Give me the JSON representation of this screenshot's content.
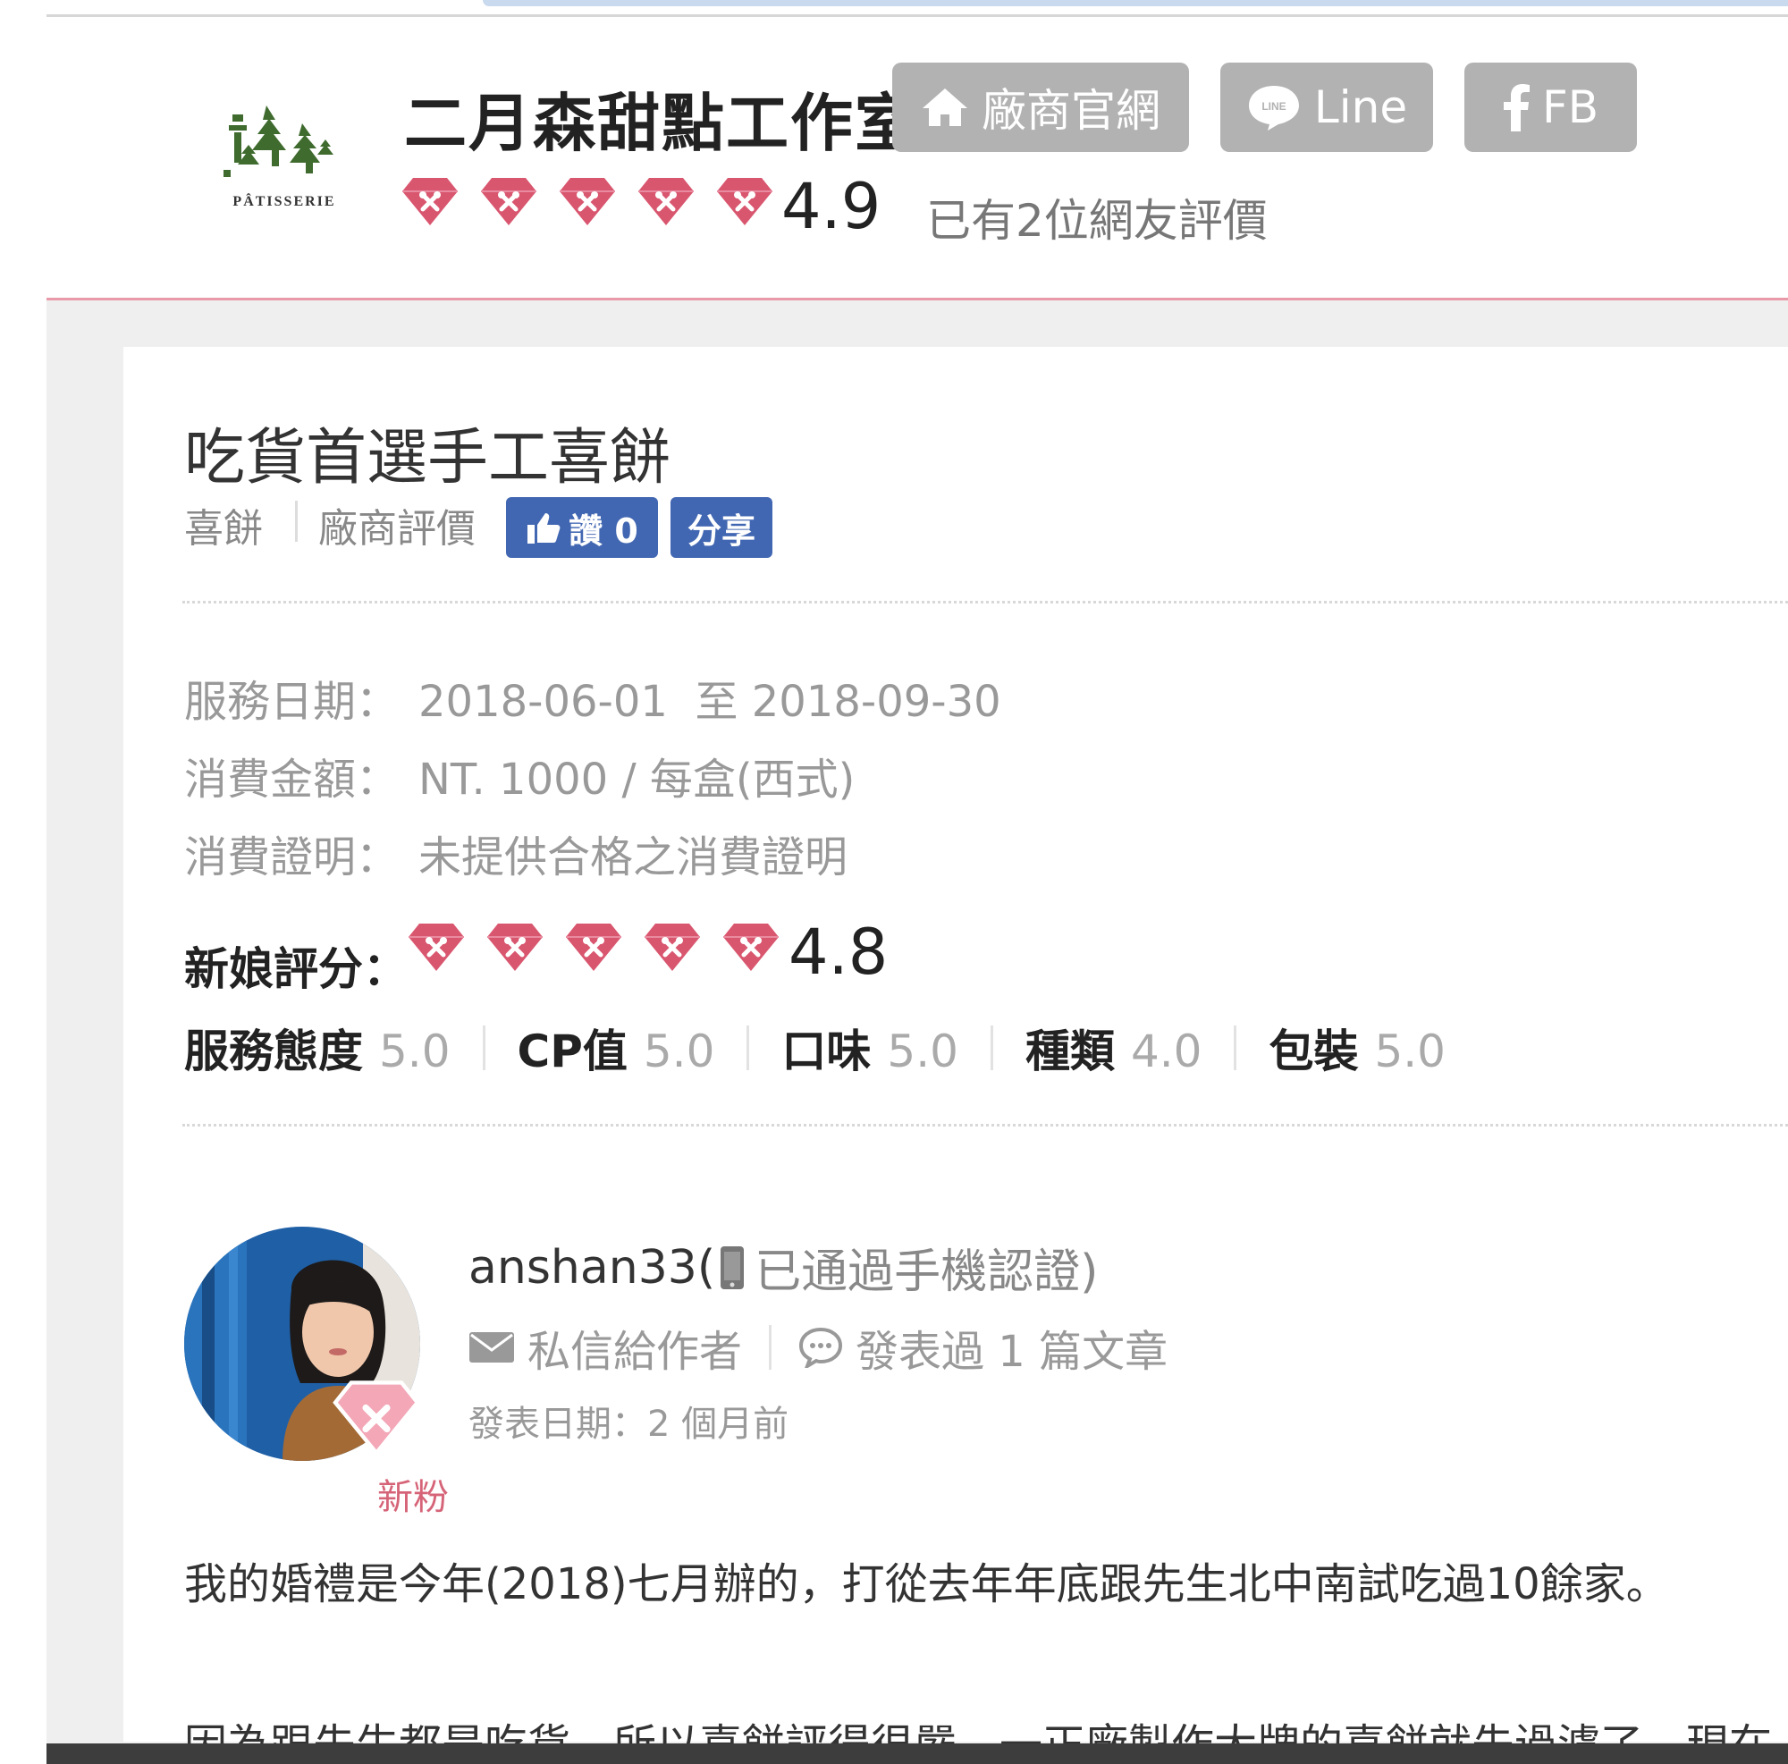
{
  "vendor": {
    "name": "二月森甜點工作室",
    "logo_text": "PÂTISSERIE",
    "rating": "4.9",
    "review_count": "已有2位網友評價",
    "buttons": {
      "website": "廠商官網",
      "line": "Line",
      "fb": "FB"
    }
  },
  "article": {
    "title": "吃貨首選手工喜餅",
    "category": "喜餅",
    "type": "廠商評價",
    "fb_like": "讚 0",
    "fb_share": "分享"
  },
  "details": {
    "service_date_label": "服務日期：",
    "service_date_value": "2018-06-01  至 2018-09-30",
    "amount_label": "消費金額：",
    "amount_value": "NT. 1000 / 每盒(西式)",
    "proof_label": "消費證明：",
    "proof_value": "未提供合格之消費證明"
  },
  "rating": {
    "label": "新娘評分：",
    "score": "4.8",
    "subratings": [
      {
        "name": "服務態度",
        "value": "5.0"
      },
      {
        "name": "CP值",
        "value": "5.0"
      },
      {
        "name": "口味",
        "value": "5.0"
      },
      {
        "name": "種類",
        "value": "4.0"
      },
      {
        "name": "包裝",
        "value": "5.0"
      }
    ]
  },
  "author": {
    "username": "anshan33(",
    "verification": "已通過手機認證)",
    "message_label": "私信給作者",
    "posts_label": "發表過 1 篇文章",
    "post_date": "發表日期：2 個月前",
    "level": "新粉"
  },
  "body": {
    "paragraph1": "我的婚禮是今年(2018)七月辦的，打從去年年底跟先生北中南試吃過10餘家。",
    "paragraph2_cut": "因為跟先生都是吃貨，所以喜餅評得很嚴，一正廠製作大牌的喜餅就先過濾了，現在"
  },
  "colors": {
    "gem": "#d9566f",
    "header_button": "#b2b2b2",
    "facebook": "#4267b2",
    "accent_line": "#e89aa8",
    "fan_label": "#d66478"
  },
  "icons": {
    "website": "home-icon",
    "line": "line-chat-icon",
    "fb": "facebook-icon",
    "like": "thumbs-up-icon",
    "phone": "phone-icon",
    "message": "envelope-icon",
    "posts": "comment-icon",
    "rating": "diamond-icon"
  }
}
